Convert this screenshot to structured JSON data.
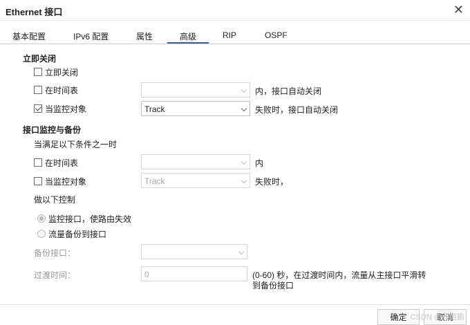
{
  "dialog": {
    "title": "Ethernet 接口",
    "close_symbol": "✕"
  },
  "tabs": [
    {
      "label": "基本配置"
    },
    {
      "label": "IPv6 配置"
    },
    {
      "label": "属性"
    },
    {
      "label": "高级",
      "active": true
    },
    {
      "label": "RIP"
    },
    {
      "label": "OSPF"
    }
  ],
  "shutdown": {
    "title": "立即关闭",
    "immediate": {
      "label": "立即关闭",
      "checked": false
    },
    "schedule": {
      "label": "在时间表",
      "checked": false,
      "select_value": "",
      "suffix": "内，接口自动关闭"
    },
    "monitor": {
      "label": "当监控对象",
      "checked": true,
      "select_value": "Track",
      "suffix": "失败时，接口自动关闭"
    }
  },
  "backup": {
    "title": "接口监控与备份",
    "condition_text": "当满足以下条件之一时",
    "schedule": {
      "label": "在时间表",
      "checked": false,
      "select_value": "",
      "suffix": "内"
    },
    "monitor": {
      "label": "当监控对象",
      "checked": false,
      "select_value": "Track",
      "suffix": "失败时，"
    },
    "action_text": "做以下控制",
    "radio_monitor": {
      "label": "监控接口，使路由失效",
      "selected": true
    },
    "radio_backup": {
      "label": "流量备份到接口",
      "selected": false
    },
    "backup_iface_label": "备份接口：",
    "backup_iface_value": "",
    "transition_label": "过渡时间：",
    "transition_value": "0",
    "transition_hint_1": "(0-60) 秒，在过渡时间内，流量从主接口平滑转",
    "transition_hint_2": "到备份接口"
  },
  "footer": {
    "ok_label": "确定",
    "cancel_label": "取消",
    "watermark": "CSDN @顾鲲鹏"
  },
  "colors": {
    "accent": "#3a5fa8",
    "disabled_text": "#9a9a9a"
  }
}
